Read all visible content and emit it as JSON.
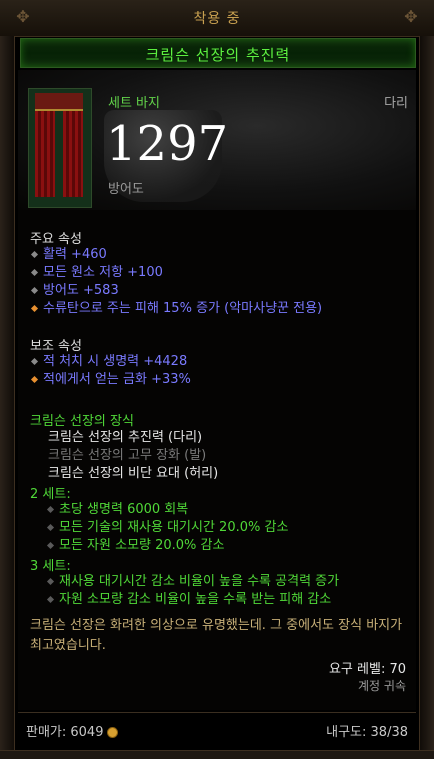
{
  "header": {
    "title": "착용 중"
  },
  "item": {
    "name": "크림슨 선장의 추진력",
    "type": "세트 바지",
    "slot": "다리",
    "armor_value": "1297",
    "armor_label": "방어도"
  },
  "primary": {
    "title": "주요 속성",
    "stats": [
      {
        "text": "활력 +460"
      },
      {
        "text": "모든 원소 저항 +100"
      },
      {
        "text": "방어도 +583"
      },
      {
        "text": "수류탄으로 주는 피해 15% 증가 (악마사냥꾼 전용)"
      }
    ]
  },
  "secondary": {
    "title": "보조 속성",
    "stats": [
      {
        "text": "적 처치 시 생명력 +4428"
      },
      {
        "text": "적에게서 얻는 금화 +33%"
      }
    ]
  },
  "set": {
    "title": "크림슨 선장의 장식",
    "pieces": [
      {
        "text": "크림슨 선장의 추진력 (다리)"
      },
      {
        "text": "크림슨 선장의 고무 장화 (발)"
      },
      {
        "text": "크림슨 선장의 비단 요대 (허리)"
      }
    ],
    "bonus2_head": "2 세트:",
    "bonus2": [
      {
        "text": "초당 생명력 6000 회복"
      },
      {
        "text": "모든 기술의 재사용 대기시간 20.0% 감소"
      },
      {
        "text": "모든 자원 소모량 20.0% 감소"
      }
    ],
    "bonus3_head": "3 세트:",
    "bonus3": [
      {
        "text": "재사용 대기시간 감소 비율이 높을 수록 공격력 증가"
      },
      {
        "text": "자원 소모량 감소 비율이 높을 수록 받는 피해 감소"
      }
    ]
  },
  "flavor": "크림슨 선장은 화려한 의상으로 유명했는데. 그 중에서도 장식 바지가 최고였습니다.",
  "requirement": "요구 레벨: 70",
  "binding": "계정 귀속",
  "footer": {
    "sell_label": "판매가: 6049",
    "durability": "내구도: 38/38"
  },
  "colors": {
    "set_green": "#50d838",
    "magic_blue": "#7a7aff",
    "legendary_orange": "#e89030",
    "flavor_gold": "#c8b078"
  }
}
